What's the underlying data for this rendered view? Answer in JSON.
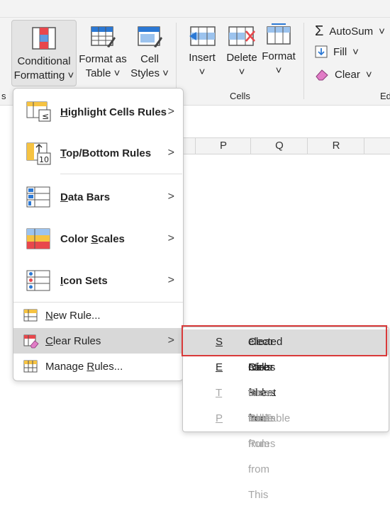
{
  "ribbon": {
    "conditional_formatting": {
      "line1": "Conditional",
      "line2": "Formatting",
      "arrow": "˅"
    },
    "format_as_table": {
      "line1": "Format as",
      "line2": "Table",
      "arrow": "˅"
    },
    "cell_styles": {
      "line1": "Cell",
      "line2": "Styles",
      "arrow": "˅"
    },
    "insert": {
      "label": "Insert",
      "arrow": "˅"
    },
    "delete": {
      "label": "Delete",
      "arrow": "˅"
    },
    "format": {
      "label": "Format",
      "arrow": "˅"
    },
    "autosum": {
      "label": "AutoSum",
      "arrow": "˅"
    },
    "fill": {
      "label": "Fill",
      "arrow": "˅"
    },
    "clear": {
      "label": "Clear",
      "arrow": "˅"
    },
    "cells_group_label": "Cells",
    "editing_group_label_partial": "Ed",
    "left_group_partial": "s"
  },
  "columns": [
    "P",
    "Q",
    "R"
  ],
  "menu": {
    "highlight": {
      "pre": "",
      "ul": "H",
      "post": "ighlight Cells Rules"
    },
    "topbottom": {
      "pre": "",
      "ul": "T",
      "post": "op/Bottom Rules"
    },
    "databars": {
      "pre": "",
      "ul": "D",
      "post": "ata Bars"
    },
    "colorscales": {
      "pre": "Color ",
      "ul": "S",
      "post": "cales"
    },
    "iconsets": {
      "pre": "",
      "ul": "I",
      "post": "con Sets"
    },
    "newrule": {
      "pre": "",
      "ul": "N",
      "post": "ew Rule..."
    },
    "clearrules": {
      "pre": "",
      "ul": "C",
      "post": "lear Rules"
    },
    "managerules": {
      "pre": "Manage ",
      "ul": "R",
      "post": "ules..."
    },
    "chevron": ">"
  },
  "submenu": {
    "selected": {
      "pre": "Clear Rules from ",
      "ul": "S",
      "post": "elected Cells"
    },
    "entire": {
      "pre": "Clear Rules from ",
      "ul": "E",
      "post": "ntire Sheet"
    },
    "table": {
      "pre": "Clear Rules from ",
      "ul": "T",
      "post": "his Table"
    },
    "pivot": {
      "pre": "Clear Rules from This ",
      "ul": "P",
      "post": "ivotTable"
    }
  },
  "colors": {
    "accent_blue": "#2b78d4",
    "red_highlight": "#d93a3a",
    "rule_red": "#e8474c",
    "rule_yellow": "#f6c342"
  }
}
